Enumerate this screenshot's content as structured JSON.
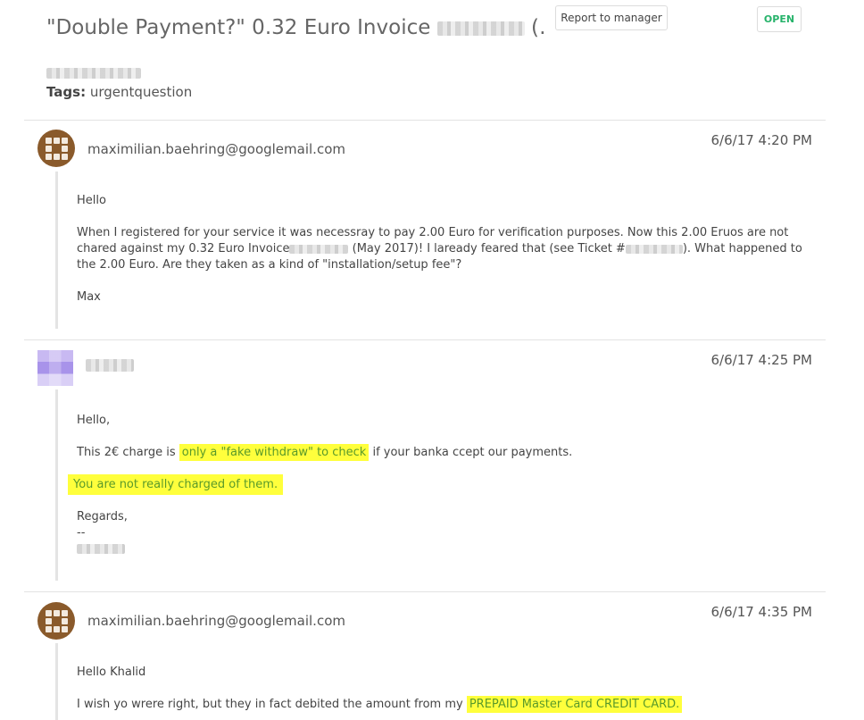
{
  "header": {
    "title_start": "\"Double Payment?\" 0.32 Euro Invoice",
    "title_end": "(…",
    "report_button": "Report to manager",
    "status": "OPEN",
    "tags_label": "Tags:",
    "tags_value": "urgentquestion"
  },
  "messages": [
    {
      "sender": "maximilian.baehring@googlemail.com",
      "time": "6/6/17 4:20 PM",
      "greeting": "Hello",
      "body_1": "When I registered for your service it was necessray to pay 2.00 Euro for verification purposes. Now this 2.00 Eruos are not chared against my 0.32 Euro Invoice",
      "body_2": "(May 2017)! I laready feared that (see Ticket #",
      "body_3": "). What happened to the 2.00 Euro. Are they taken as a kind of \"installation/setup fee\"?",
      "signoff": "Max"
    },
    {
      "time": "6/6/17 4:25 PM",
      "greeting": "Hello,",
      "body_pre": "This 2€ charge is ",
      "body_highlight": "only a \"fake withdraw\" to check",
      "body_post": " if your banka ccept our payments.",
      "highlight_line": "You are not really charged of them.",
      "regards": "Regards,",
      "dash": "--"
    },
    {
      "sender": "maximilian.baehring@googlemail.com",
      "time": "6/6/17 4:35 PM",
      "greeting": "Hello Khalid",
      "body_pre": "I wish yo wrere right, but they in fact debited the amount from my ",
      "body_highlight": "PREPAID Master Card CREDIT CARD."
    }
  ],
  "colors": {
    "status_green": "#27b36b",
    "highlight_yellow": "#ffff3c",
    "highlight_text": "#5a9a2a",
    "avatar_brown": "#8a5a2b"
  }
}
